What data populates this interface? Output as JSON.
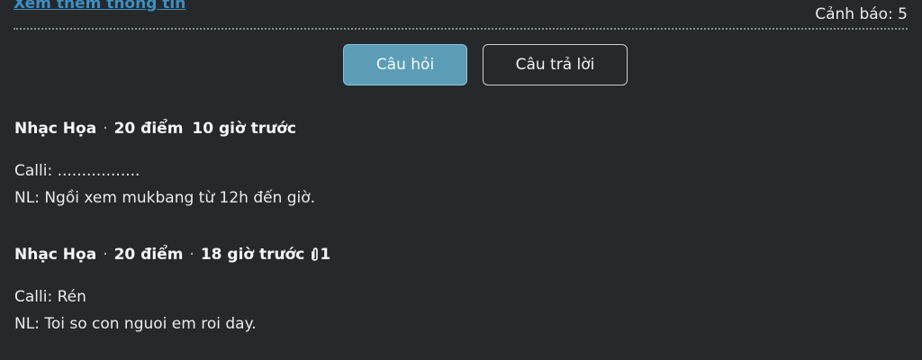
{
  "header": {
    "more_info_link": "Xem thêm thông tin",
    "warning": "Cảnh báo: 5"
  },
  "tabs": [
    {
      "label": "Câu hỏi",
      "active": true
    },
    {
      "label": "Câu trả lời",
      "active": false
    }
  ],
  "entries": [
    {
      "author": "Nhạc Họa",
      "points": "20 điểm",
      "time": "10 giờ trước",
      "lines": [
        "Calli: .................",
        "NL: Ngồi xem mukbang từ 12h đến giờ."
      ]
    },
    {
      "author": "Nhạc Họa",
      "points": "20 điểm",
      "time": "18 giờ trước",
      "attachment_count": "1",
      "lines": [
        "Calli: Rén",
        "NL: Toi so con nguoi em roi day."
      ]
    }
  ],
  "icons": {
    "attachment": "paperclip-icon",
    "separator": "·"
  },
  "colors": {
    "background": "#25292b",
    "link": "#3e8fc2",
    "active_tab": "#5b9db7"
  }
}
